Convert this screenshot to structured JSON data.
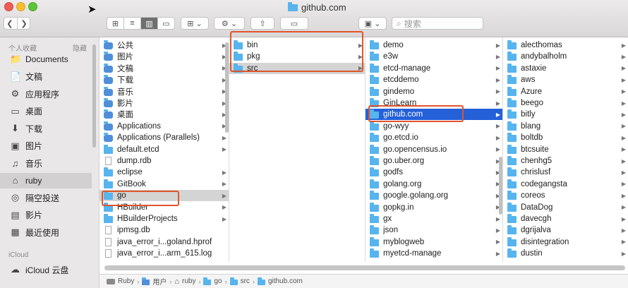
{
  "window": {
    "title": "github.com"
  },
  "toolbar": {
    "back": "❮",
    "forward": "❯",
    "view_icons": "⊞",
    "view_list": "≡",
    "view_columns": "▥",
    "view_gallery": "▭",
    "group": "⊞ ⌄",
    "action": "⚙ ⌄",
    "share": "⇧",
    "tag": "▭",
    "extra": "▣ ⌄",
    "search_placeholder": "搜索",
    "search_icon": "⌕"
  },
  "sidebar": {
    "favorites_header": "个人收藏",
    "hide_label": "隐藏",
    "items": [
      {
        "label": "Documents",
        "icon": "📁"
      },
      {
        "label": "文稿",
        "icon": "📄"
      },
      {
        "label": "应用程序",
        "icon": "⚙"
      },
      {
        "label": "桌面",
        "icon": "▭"
      },
      {
        "label": "下载",
        "icon": "⬇"
      },
      {
        "label": "图片",
        "icon": "▣"
      },
      {
        "label": "音乐",
        "icon": "♫"
      },
      {
        "label": "ruby",
        "icon": "⌂"
      },
      {
        "label": "隔空投送",
        "icon": "◎"
      },
      {
        "label": "影片",
        "icon": "▤"
      },
      {
        "label": "最近使用",
        "icon": "▦"
      }
    ],
    "icloud_header": "iCloud",
    "icloud_items": [
      {
        "label": "iCloud 云盘",
        "icon": "☁"
      }
    ]
  },
  "columns": [
    {
      "items": [
        {
          "name": "公共",
          "type": "app",
          "arrow": true
        },
        {
          "name": "图片",
          "type": "app",
          "arrow": true
        },
        {
          "name": "文稿",
          "type": "app",
          "arrow": true
        },
        {
          "name": "下载",
          "type": "app",
          "arrow": true
        },
        {
          "name": "音乐",
          "type": "app",
          "arrow": true
        },
        {
          "name": "影片",
          "type": "app",
          "arrow": true
        },
        {
          "name": "桌面",
          "type": "app",
          "arrow": true
        },
        {
          "name": "Applications",
          "type": "app",
          "arrow": true
        },
        {
          "name": "Applications (Parallels)",
          "type": "app",
          "arrow": true
        },
        {
          "name": "default.etcd",
          "type": "folder",
          "arrow": true
        },
        {
          "name": "dump.rdb",
          "type": "file",
          "arrow": false
        },
        {
          "name": "eclipse",
          "type": "folder",
          "arrow": true
        },
        {
          "name": "GitBook",
          "type": "folder",
          "arrow": true
        },
        {
          "name": "go",
          "type": "folder",
          "arrow": true,
          "selected": true
        },
        {
          "name": "HBuilder",
          "type": "folder",
          "arrow": true
        },
        {
          "name": "HBuilderProjects",
          "type": "folder",
          "arrow": true
        },
        {
          "name": "ipmsg.db",
          "type": "file",
          "arrow": false
        },
        {
          "name": "java_error_i...goland.hprof",
          "type": "file",
          "arrow": false
        },
        {
          "name": "java_error_i...arm_615.log",
          "type": "file",
          "arrow": false
        }
      ]
    },
    {
      "items": [
        {
          "name": "bin",
          "type": "folder",
          "arrow": true
        },
        {
          "name": "pkg",
          "type": "folder",
          "arrow": true
        },
        {
          "name": "src",
          "type": "folder",
          "arrow": true,
          "selected": true
        }
      ]
    },
    {
      "items": [
        {
          "name": "demo",
          "type": "folder",
          "arrow": true
        },
        {
          "name": "e3w",
          "type": "folder",
          "arrow": true
        },
        {
          "name": "etcd-manage",
          "type": "folder",
          "arrow": true
        },
        {
          "name": "etcddemo",
          "type": "folder",
          "arrow": true
        },
        {
          "name": "gindemo",
          "type": "folder",
          "arrow": true
        },
        {
          "name": "GinLearn",
          "type": "folder",
          "arrow": true
        },
        {
          "name": "github.com",
          "type": "folder",
          "arrow": true,
          "active": true
        },
        {
          "name": "go-wyy",
          "type": "folder",
          "arrow": true
        },
        {
          "name": "go.etcd.io",
          "type": "folder",
          "arrow": true
        },
        {
          "name": "go.opencensus.io",
          "type": "folder",
          "arrow": true
        },
        {
          "name": "go.uber.org",
          "type": "folder",
          "arrow": true
        },
        {
          "name": "godfs",
          "type": "folder",
          "arrow": true
        },
        {
          "name": "golang.org",
          "type": "folder",
          "arrow": true
        },
        {
          "name": "google.golang.org",
          "type": "folder",
          "arrow": true
        },
        {
          "name": "gopkg.in",
          "type": "folder",
          "arrow": true
        },
        {
          "name": "gx",
          "type": "folder",
          "arrow": true
        },
        {
          "name": "json",
          "type": "folder",
          "arrow": true
        },
        {
          "name": "myblogweb",
          "type": "folder",
          "arrow": true
        },
        {
          "name": "myetcd-manage",
          "type": "folder",
          "arrow": true
        }
      ]
    },
    {
      "items": [
        {
          "name": "alecthomas",
          "type": "folder",
          "arrow": true
        },
        {
          "name": "andybalholm",
          "type": "folder",
          "arrow": true
        },
        {
          "name": "astaxie",
          "type": "folder",
          "arrow": true
        },
        {
          "name": "aws",
          "type": "folder",
          "arrow": true
        },
        {
          "name": "Azure",
          "type": "folder",
          "arrow": true
        },
        {
          "name": "beego",
          "type": "folder",
          "arrow": true
        },
        {
          "name": "bitly",
          "type": "folder",
          "arrow": true
        },
        {
          "name": "blang",
          "type": "folder",
          "arrow": true
        },
        {
          "name": "boltdb",
          "type": "folder",
          "arrow": true
        },
        {
          "name": "btcsuite",
          "type": "folder",
          "arrow": true
        },
        {
          "name": "chenhg5",
          "type": "folder",
          "arrow": true
        },
        {
          "name": "chrislusf",
          "type": "folder",
          "arrow": true
        },
        {
          "name": "codegangsta",
          "type": "folder",
          "arrow": true
        },
        {
          "name": "coreos",
          "type": "folder",
          "arrow": true
        },
        {
          "name": "DataDog",
          "type": "folder",
          "arrow": true
        },
        {
          "name": "davecgh",
          "type": "folder",
          "arrow": true
        },
        {
          "name": "dgrijalva",
          "type": "folder",
          "arrow": true
        },
        {
          "name": "disintegration",
          "type": "folder",
          "arrow": true
        },
        {
          "name": "dustin",
          "type": "folder",
          "arrow": true
        }
      ]
    }
  ],
  "pathbar": [
    {
      "label": "Ruby",
      "icon": "disk"
    },
    {
      "label": "用户",
      "icon": "app"
    },
    {
      "label": "ruby",
      "icon": "home"
    },
    {
      "label": "go",
      "icon": "folder"
    },
    {
      "label": "src",
      "icon": "folder"
    },
    {
      "label": "github.com",
      "icon": "folder"
    }
  ],
  "path_separator": "›",
  "colors": {
    "selection": "#2460d8",
    "highlight_box": "#e0552b",
    "folder": "#56b4ee"
  }
}
